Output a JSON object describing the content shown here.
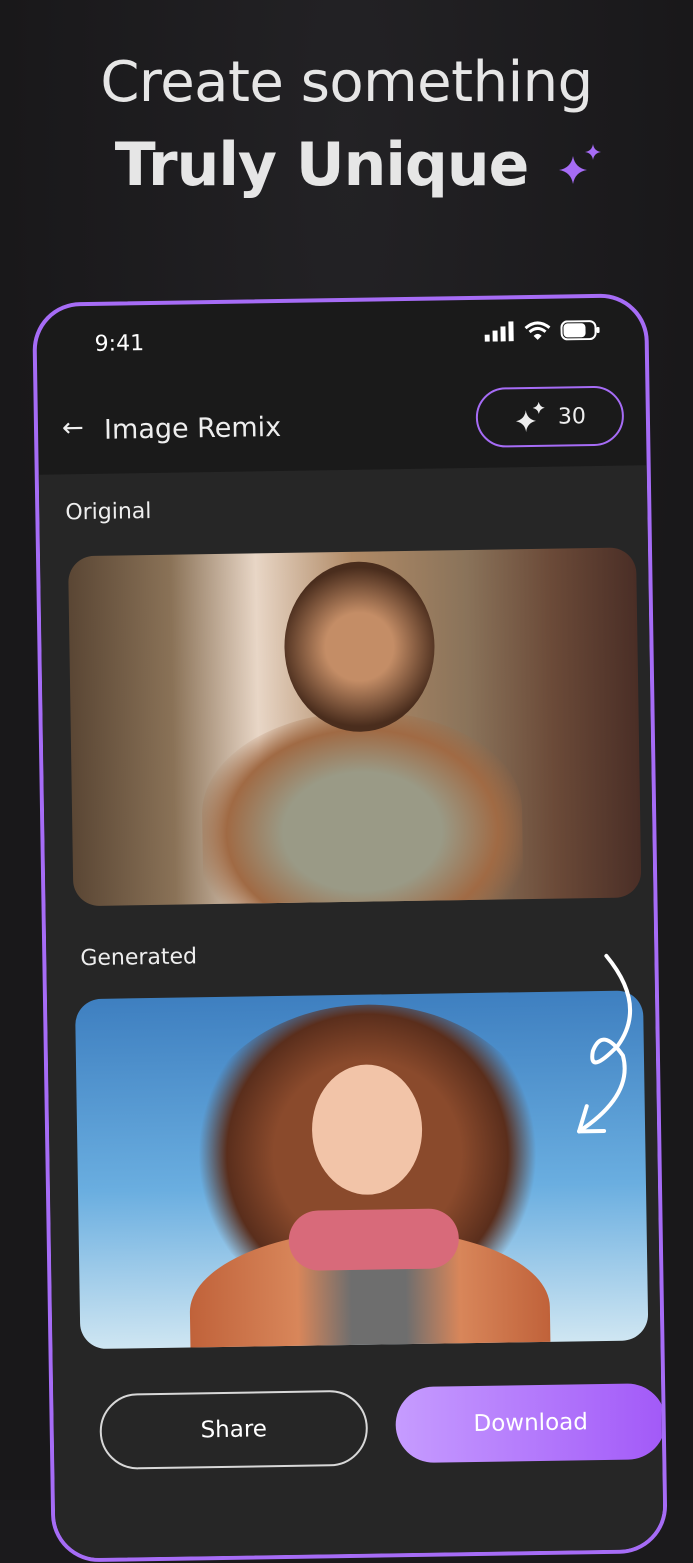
{
  "headline": {
    "line1": "Create something",
    "line2": "Truly Unique"
  },
  "status_bar": {
    "time": "9:41"
  },
  "app_bar": {
    "title": "Image Remix",
    "credits": "30"
  },
  "sections": {
    "original_label": "Original",
    "generated_label": "Generated"
  },
  "actions": {
    "share": "Share",
    "download": "Download"
  },
  "colors": {
    "accent": "#a66cf6",
    "background": "#1b1a1c"
  }
}
